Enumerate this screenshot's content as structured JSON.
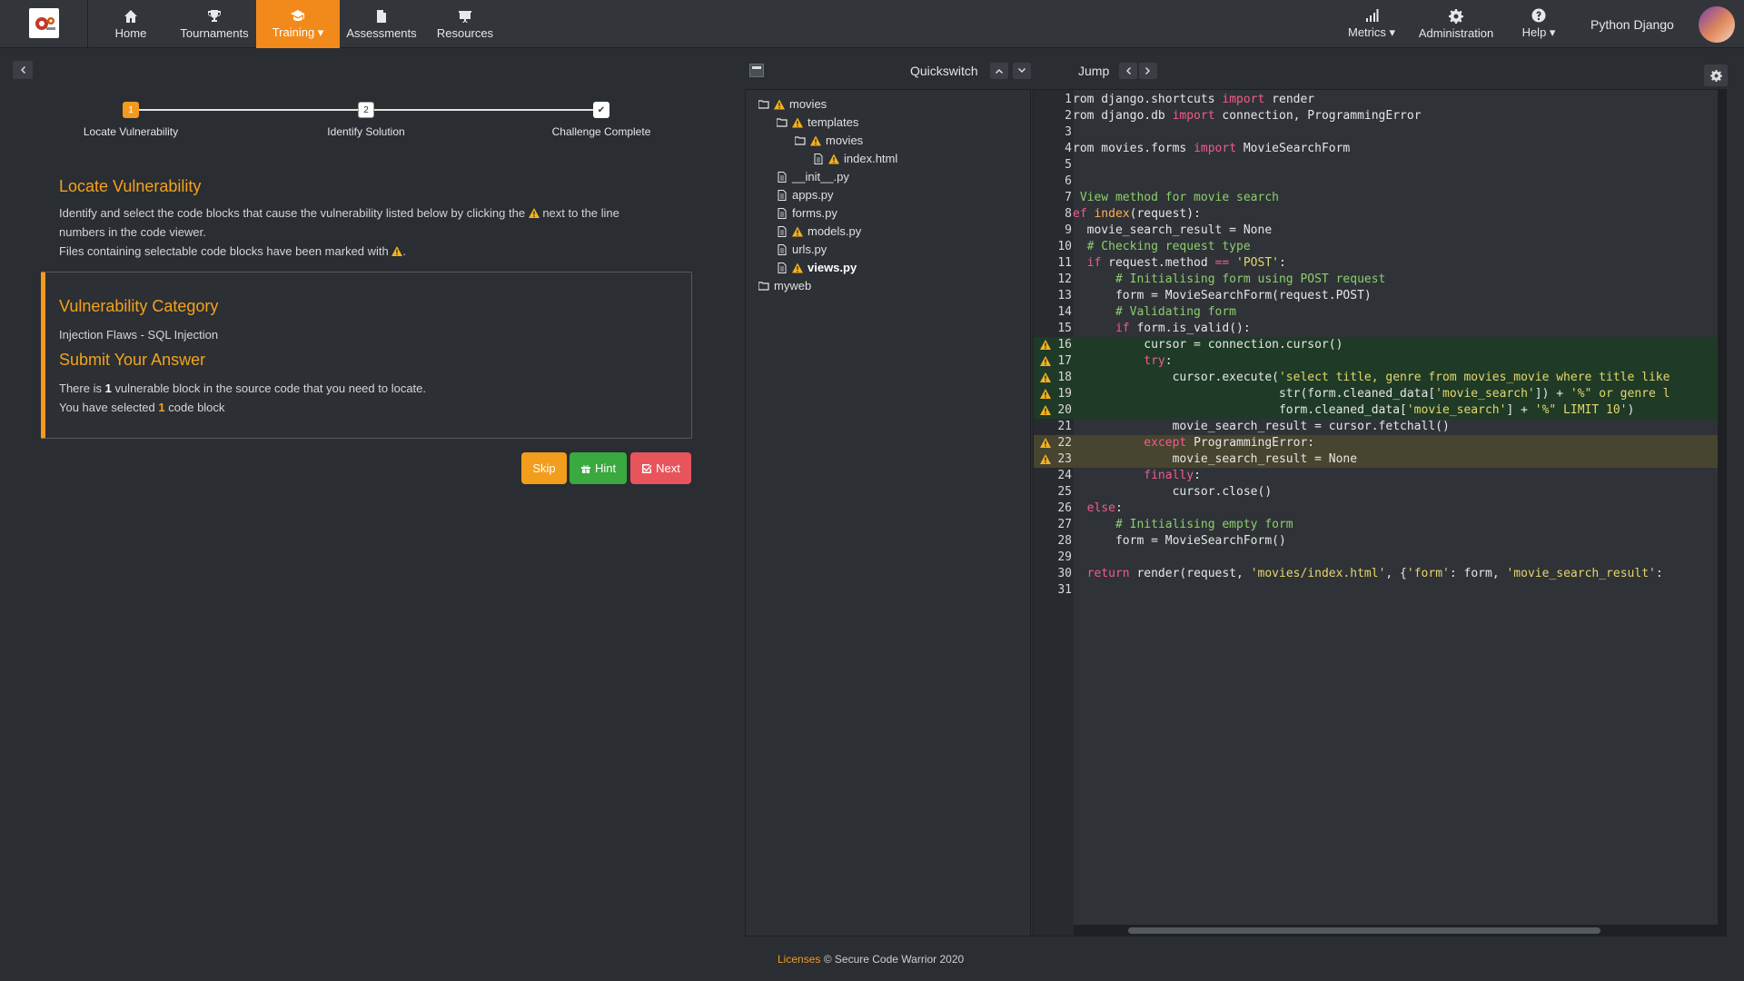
{
  "nav": {
    "items": [
      {
        "label": "Home",
        "icon": "home-icon"
      },
      {
        "label": "Tournaments",
        "icon": "trophy-icon"
      },
      {
        "label": "Training ▾",
        "icon": "graduation-cap-icon"
      },
      {
        "label": "Assessments",
        "icon": "document-icon"
      },
      {
        "label": "Resources",
        "icon": "presentation-icon"
      },
      {
        "label": "Metrics ▾",
        "icon": "bar-chart-icon"
      },
      {
        "label": "Administration",
        "icon": "gear-icon"
      },
      {
        "label": "Help ▾",
        "icon": "question-icon"
      }
    ],
    "user_name": "Python Django",
    "accent": "#f28a1b"
  },
  "stepper": {
    "steps": [
      {
        "number": "1",
        "label": "Locate Vulnerability"
      },
      {
        "number": "2",
        "label": "Identify Solution"
      },
      {
        "number": "✔",
        "label": "Challenge Complete"
      }
    ]
  },
  "locate": {
    "title": "Locate Vulnerability",
    "line1a": "Identify and select the code blocks that cause the vulnerability listed below by clicking the",
    "line1b": "next to the line",
    "line2": "numbers in the code viewer.",
    "line3": "Files containing selectable code blocks have been marked with",
    "line3_end": "."
  },
  "card": {
    "category_title": "Vulnerability Category",
    "category_value": "Injection Flaws - SQL Injection",
    "submit_title": "Submit Your Answer",
    "blocks_a": "There is",
    "blocks_count": "1",
    "blocks_b": "vulnerable block in the source code that you need to locate.",
    "selected_a": "You have selected",
    "selected_count": "1",
    "selected_b": "code block"
  },
  "buttons": {
    "skip": "Skip",
    "hint": "Hint",
    "next": "Next",
    "skip_color": "#f29d1c",
    "hint_color": "#3aa93f",
    "next_color": "#e8545b"
  },
  "viewer": {
    "quickswitch": "Quickswitch",
    "jump": "Jump"
  },
  "tree": [
    {
      "label": "movies",
      "type": "folder",
      "warn": true
    },
    {
      "label": "templates",
      "type": "folder",
      "warn": true
    },
    {
      "label": "movies",
      "type": "folder",
      "warn": true
    },
    {
      "label": "index.html",
      "type": "file",
      "warn": true
    },
    {
      "label": "__init__.py",
      "type": "file",
      "warn": false
    },
    {
      "label": "apps.py",
      "type": "file",
      "warn": false
    },
    {
      "label": "forms.py",
      "type": "file",
      "warn": false
    },
    {
      "label": "models.py",
      "type": "file",
      "warn": true
    },
    {
      "label": "urls.py",
      "type": "file",
      "warn": false
    },
    {
      "label": "views.py",
      "type": "file",
      "warn": true,
      "bold": true
    },
    {
      "label": "myweb",
      "type": "folder",
      "warn": false
    }
  ],
  "code": {
    "lines": [
      {
        "n": "1",
        "t": "rom django.shortcuts import render"
      },
      {
        "n": "2",
        "t": "rom django.db import connection, ProgrammingError"
      },
      {
        "n": "3",
        "t": ""
      },
      {
        "n": "4",
        "t": "rom movies.forms import MovieSearchForm"
      },
      {
        "n": "5",
        "t": ""
      },
      {
        "n": "6",
        "t": ""
      },
      {
        "n": "7",
        "t": " View method for movie search"
      },
      {
        "n": "8",
        "t": "ef index(request):"
      },
      {
        "n": "9",
        "t": "  movie_search_result = None"
      },
      {
        "n": "10",
        "t": "  # Checking request type"
      },
      {
        "n": "11",
        "t": "  if request.method == 'POST':"
      },
      {
        "n": "12",
        "t": "      # Initialising form using POST request"
      },
      {
        "n": "13",
        "t": "      form = MovieSearchForm(request.POST)"
      },
      {
        "n": "14",
        "t": "      # Validating form"
      },
      {
        "n": "15",
        "t": "      if form.is_valid():"
      },
      {
        "n": "16",
        "t": "          cursor = connection.cursor()"
      },
      {
        "n": "17",
        "t": "          try:"
      },
      {
        "n": "18",
        "t": "              cursor.execute('select title, genre from movies_movie where title like"
      },
      {
        "n": "19",
        "t": "                             str(form.cleaned_data['movie_search']) + '%\" or genre l"
      },
      {
        "n": "20",
        "t": "                             form.cleaned_data['movie_search'] + '%\" LIMIT 10')"
      },
      {
        "n": "21",
        "t": "              movie_search_result = cursor.fetchall()"
      },
      {
        "n": "22",
        "t": "          except ProgrammingError:"
      },
      {
        "n": "23",
        "t": "              movie_search_result = None"
      },
      {
        "n": "24",
        "t": "          finally:"
      },
      {
        "n": "25",
        "t": "              cursor.close()"
      },
      {
        "n": "26",
        "t": "  else:"
      },
      {
        "n": "27",
        "t": "      # Initialising empty form"
      },
      {
        "n": "28",
        "t": "      form = MovieSearchForm()"
      },
      {
        "n": "29",
        "t": ""
      },
      {
        "n": "30",
        "t": "  return render(request, 'movies/index.html', {'form': form, 'movie_search_result':"
      },
      {
        "n": "31",
        "t": ""
      }
    ],
    "warn_lines": [
      "16",
      "17",
      "18",
      "19",
      "20",
      "22",
      "23"
    ],
    "green_lines": [
      "16",
      "17",
      "18",
      "19",
      "20"
    ],
    "olive_lines": [
      "22",
      "23"
    ]
  },
  "footer": {
    "licenses": "Licenses",
    "copyright": "© Secure Code Warrior 2020"
  }
}
